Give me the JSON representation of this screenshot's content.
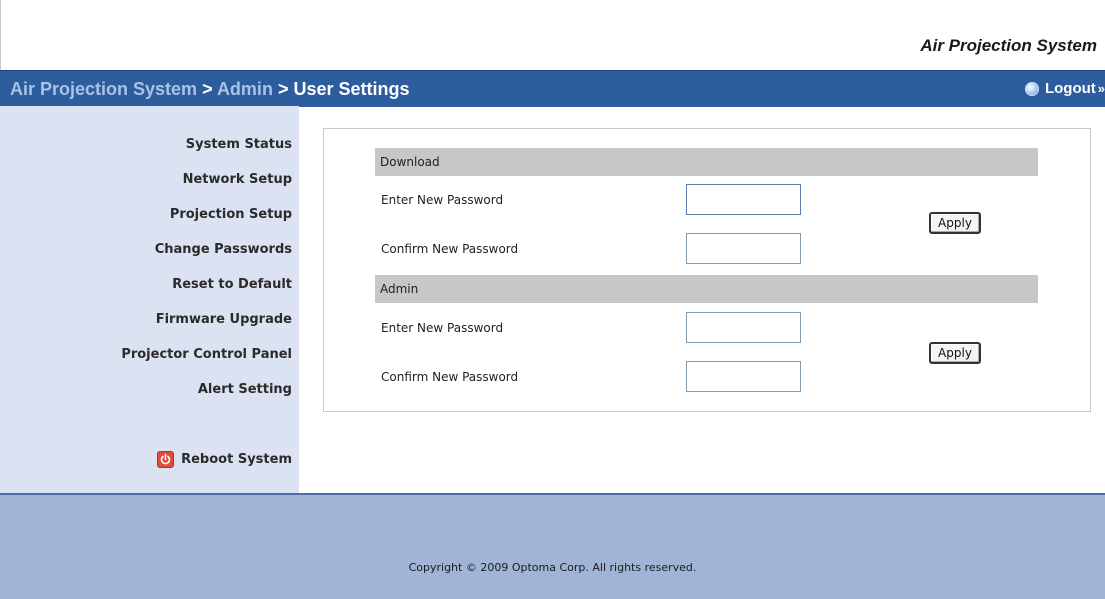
{
  "header": {
    "brand": "Air Projection System"
  },
  "breadcrumb": {
    "items": [
      "Air Projection System",
      "Admin",
      "User Settings"
    ],
    "separator": ">"
  },
  "logout": {
    "label": "Logout",
    "suffix": "»",
    "icon": "globe-icon"
  },
  "sidebar": {
    "items": [
      {
        "label": "System Status"
      },
      {
        "label": "Network Setup"
      },
      {
        "label": "Projection Setup"
      },
      {
        "label": "Change Passwords"
      },
      {
        "label": "Reset to Default"
      },
      {
        "label": "Firmware Upgrade"
      },
      {
        "label": "Projector Control Panel"
      },
      {
        "label": "Alert Setting"
      }
    ],
    "reboot": {
      "label": "Reboot System",
      "icon": "power-icon"
    }
  },
  "sections": {
    "download": {
      "title": "Download",
      "new_label": "Enter New Password",
      "new_value": "",
      "confirm_label": "Confirm New Password",
      "confirm_value": "",
      "apply_label": "Apply"
    },
    "admin": {
      "title": "Admin",
      "new_label": "Enter New Password",
      "new_value": "",
      "confirm_label": "Confirm New Password",
      "confirm_value": "",
      "apply_label": "Apply"
    }
  },
  "footer": {
    "copyright": "Copyright © 2009 Optoma Corp. All rights reserved."
  },
  "colors": {
    "title_bar": "#2e5d9e",
    "sidebar_bg": "#dbe2f1",
    "footer_bg": "#9fb4d7",
    "section_header": "#c8c6c8",
    "breadcrumb_link": "#a9c3e6"
  }
}
